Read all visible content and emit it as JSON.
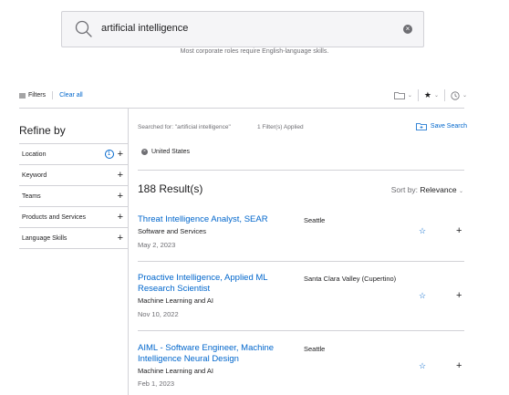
{
  "search": {
    "value": "artificial intelligence",
    "hint": "Most corporate roles require English-language skills."
  },
  "filters_bar": {
    "filters_label": "Filters",
    "clear_all": "Clear all"
  },
  "toolbar": {
    "icons": [
      "folder-icon",
      "star-icon",
      "history-icon"
    ]
  },
  "refine": {
    "title": "Refine by",
    "items": [
      {
        "label": "Location",
        "count": "1"
      },
      {
        "label": "Keyword"
      },
      {
        "label": "Teams"
      },
      {
        "label": "Products and Services"
      },
      {
        "label": "Language Skills"
      }
    ]
  },
  "summary": {
    "searched_for": "Searched for: \"artificial intelligence\"",
    "filters_applied": "1 Filter(s) Applied",
    "save_search": "Save Search",
    "chip": "United States"
  },
  "results": {
    "count": "188 Result(s)",
    "sort_label": "Sort by:",
    "sort_value": "Relevance",
    "jobs": [
      {
        "title": "Threat Intelligence Analyst, SEAR",
        "team": "Software and Services",
        "date": "May 2, 2023",
        "location": "Seattle"
      },
      {
        "title": "Proactive Intelligence, Applied ML Research Scientist",
        "team": "Machine Learning and AI",
        "date": "Nov 10, 2022",
        "location": "Santa Clara Valley (Cupertino)"
      },
      {
        "title": "AIML - Software Engineer, Machine Intelligence Neural Design",
        "team": "Machine Learning and AI",
        "date": "Feb 1, 2023",
        "location": "Seattle"
      }
    ]
  },
  "colors": {
    "accent": "#0066cc",
    "text": "#1d1d1f",
    "muted": "#6e6e73",
    "border": "#d2d2d7"
  }
}
